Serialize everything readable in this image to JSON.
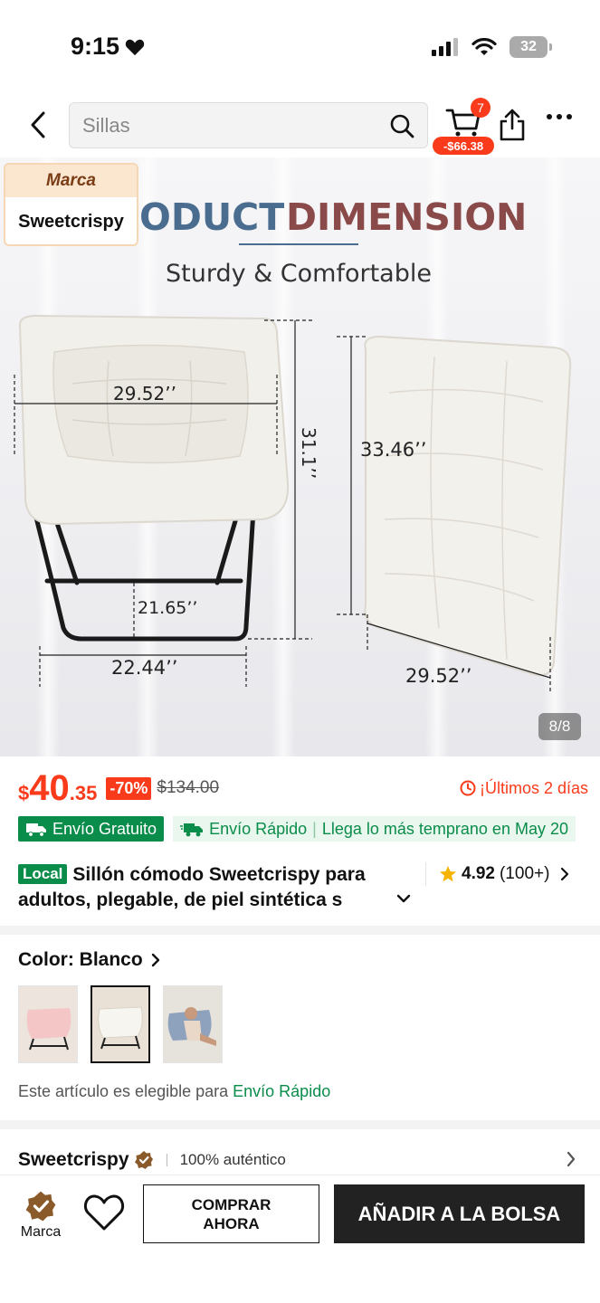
{
  "status_bar": {
    "time": "9:15",
    "battery": "32"
  },
  "nav": {
    "search_placeholder": "Sillas",
    "cart_count": "7",
    "cart_discount": "-$66.38"
  },
  "gallery": {
    "brand_label": "Marca",
    "brand_name": "Sweetcrispy",
    "heading_left": "ODUCT",
    "heading_right": "DIMENSION",
    "subheading": "Sturdy & Comfortable",
    "dims": {
      "width_top": "29.52’’",
      "height": "31.1’’",
      "inner_width": "21.65’’",
      "base_width": "22.44’’",
      "cushion_height": "33.46’’",
      "cushion_width": "29.52’’"
    },
    "counter": "8/8"
  },
  "price": {
    "currency": "$",
    "integer": "40",
    "decimal": ".35",
    "discount": "-70%",
    "original": "$134.00",
    "urgency": "¡Últimos 2 días"
  },
  "shipping": {
    "free": "Envío Gratuito",
    "fast": "Envío Rápido",
    "separator": "|",
    "arrival": "Llega lo más temprano en May 20"
  },
  "product": {
    "local_badge": "Local",
    "title": "Sillón cómodo Sweetcrispy para adultos, plegable, de piel sintética s",
    "rating": "4.92",
    "reviews": "(100+)"
  },
  "color": {
    "label": "Color: Blanco",
    "options": [
      "Rosa",
      "Blanco",
      "Azul"
    ],
    "selected_index": 1,
    "eligible_text": "Este artículo es elegible para ",
    "eligible_link": "Envío Rápido"
  },
  "store": {
    "name": "Sweetcrispy",
    "authentic": "100% auténtico"
  },
  "bottom_bar": {
    "brand_label": "Marca",
    "buy_now": "COMPRAR AHORA",
    "add_to_bag": "AÑADIR A LA BOLSA"
  },
  "colors": {
    "accent": "#fa3b1b",
    "green": "#0a8c4a",
    "dark_button": "#222222",
    "heading_blue": "#4a6c8e",
    "heading_red": "#8b4a4a"
  }
}
